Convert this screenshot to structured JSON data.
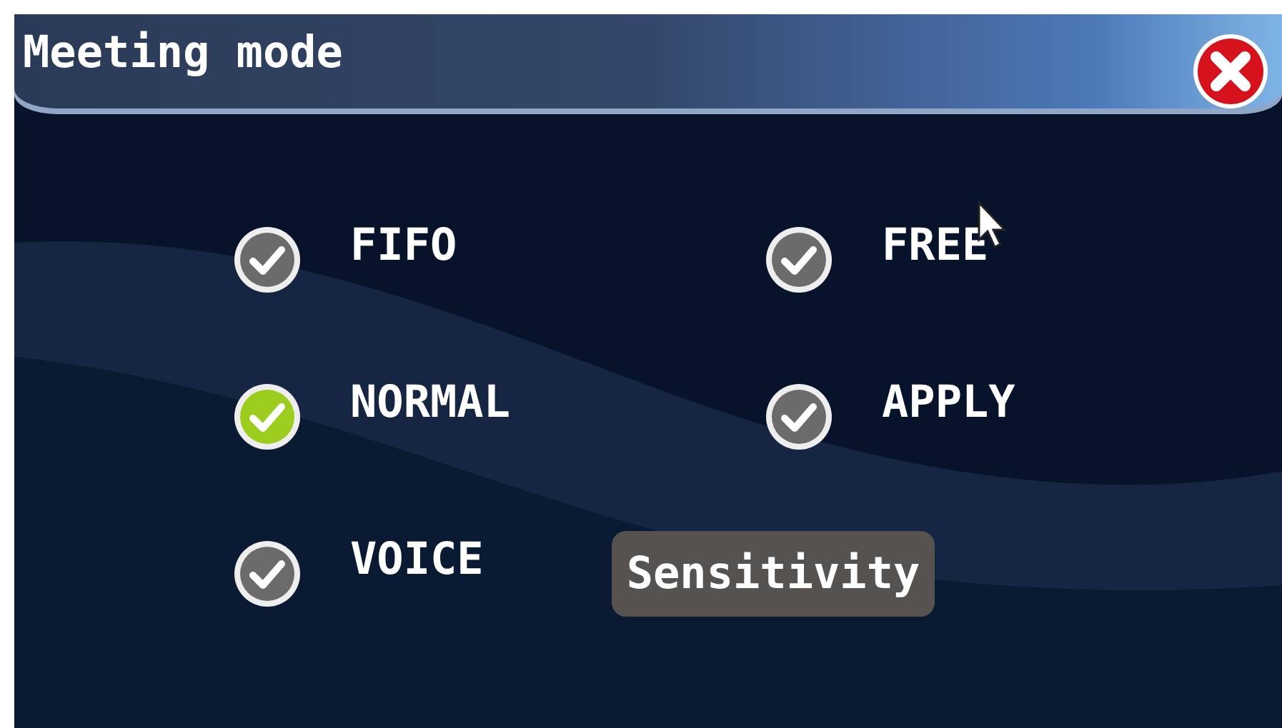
{
  "window": {
    "title": "Meeting mode"
  },
  "options": [
    {
      "label": "FIFO",
      "selected": false
    },
    {
      "label": "FREE",
      "selected": false
    },
    {
      "label": "NORMAL",
      "selected": true
    },
    {
      "label": "APPLY",
      "selected": false
    },
    {
      "label": "VOICE",
      "selected": false
    }
  ],
  "buttons": [
    "Sensitivity"
  ]
}
